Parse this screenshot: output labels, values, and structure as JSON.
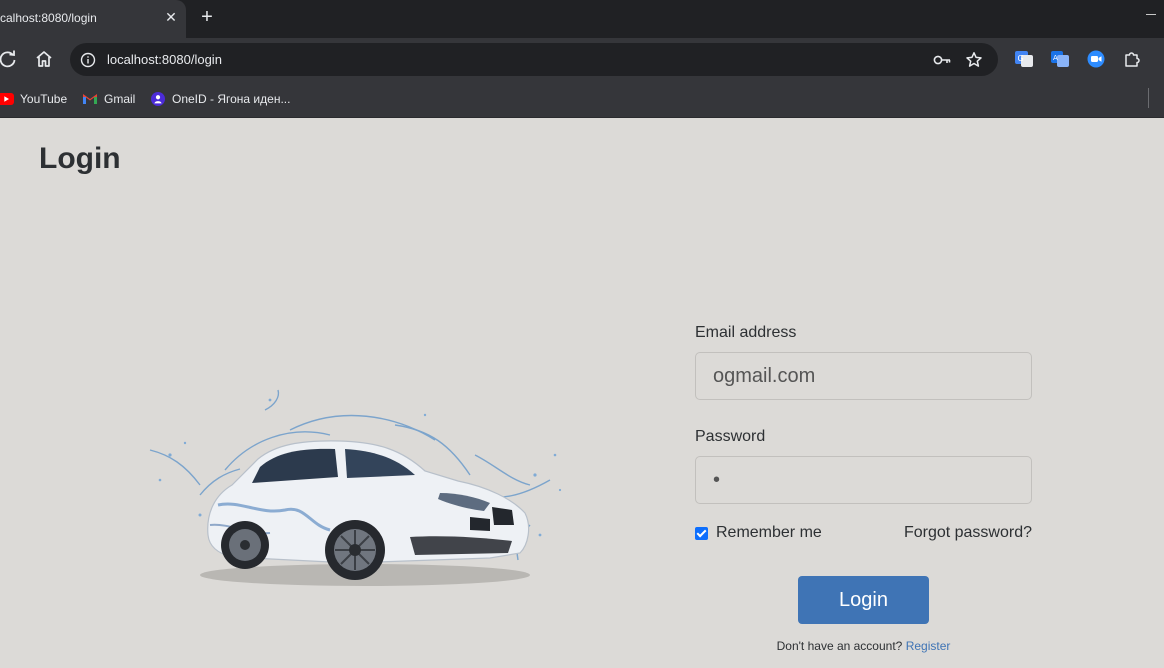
{
  "browser": {
    "tab_title": "calhost:8080/login",
    "tab_close": "✕",
    "new_tab": "+",
    "url": "localhost:8080/login",
    "bookmarks": [
      {
        "label": "YouTube",
        "icon": "youtube-icon"
      },
      {
        "label": "Gmail",
        "icon": "gmail-icon"
      },
      {
        "label": "OneID - Ягона иден...",
        "icon": "oneid-icon"
      }
    ]
  },
  "page": {
    "title": "Login",
    "email_label": "Email address",
    "email_value": "ogmail.com",
    "password_label": "Password",
    "password_value": "•",
    "remember_label": "Remember me",
    "remember_checked": true,
    "forgot_label": "Forgot password?",
    "login_button": "Login",
    "register_prompt": "Don't have an account?",
    "register_link": "Register"
  },
  "colors": {
    "page_bg": "#dcdad7",
    "button": "#3f74b5",
    "link": "#3f74b5",
    "checkbox": "#0d6efd",
    "chrome_dark": "#202124",
    "chrome_toolbar": "#35363a"
  }
}
